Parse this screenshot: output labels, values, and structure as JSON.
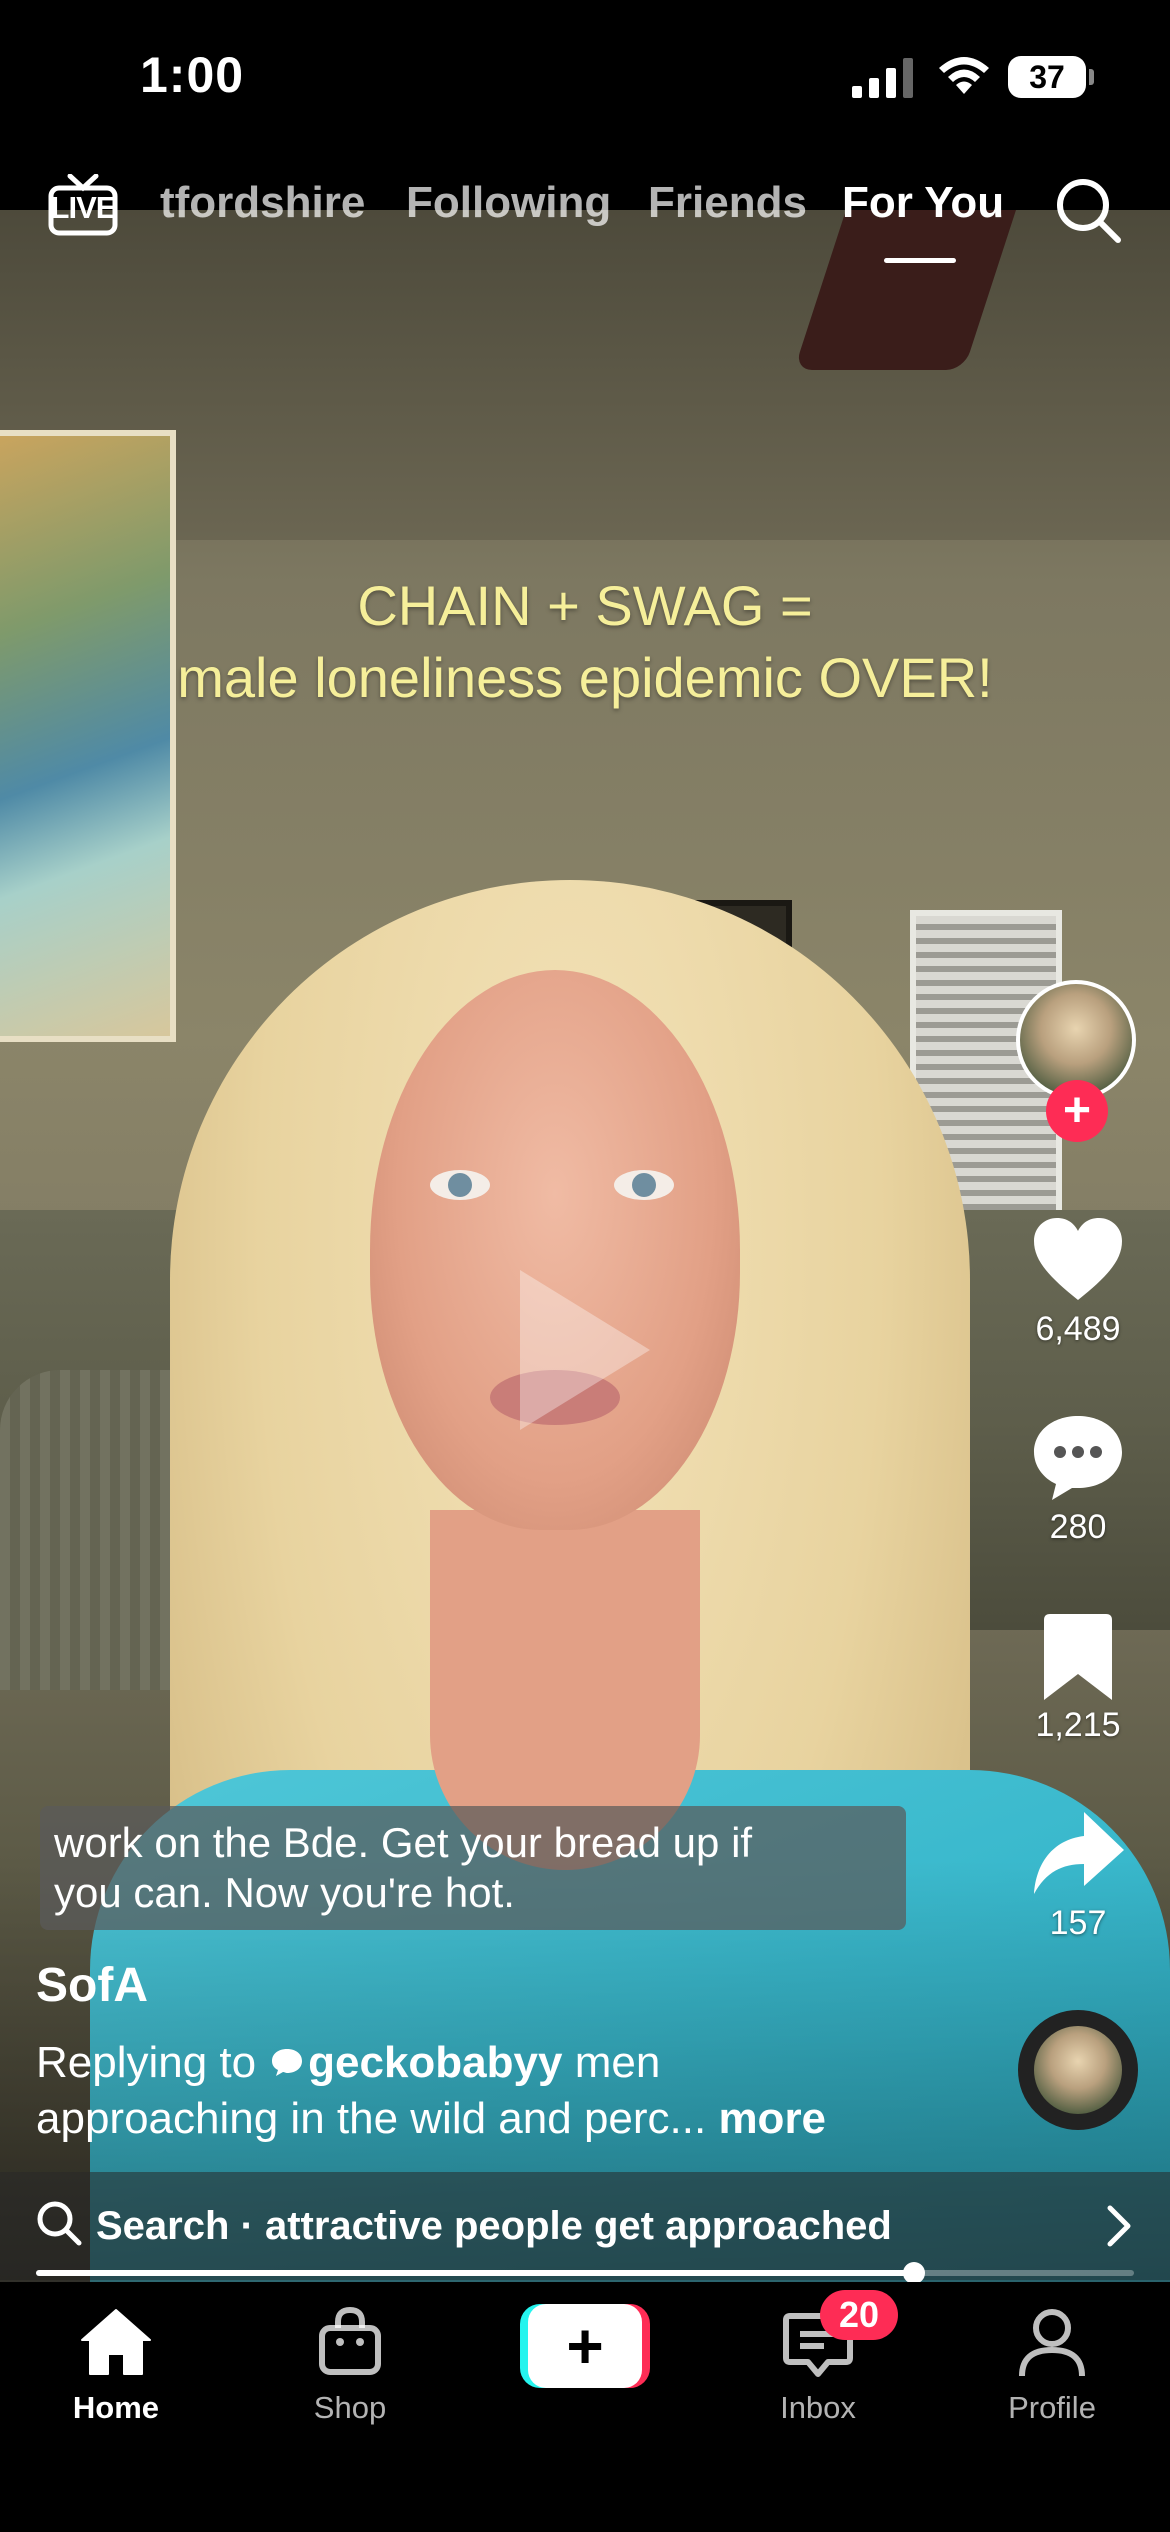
{
  "status_bar": {
    "time": "1:00",
    "battery": "37"
  },
  "top_nav": {
    "live_label": "LIVE",
    "tabs": [
      {
        "label": "tfordshire",
        "active": false
      },
      {
        "label": "Following",
        "active": false
      },
      {
        "label": "Friends",
        "active": false
      },
      {
        "label": "For You",
        "active": true
      }
    ],
    "search_icon": "search-icon"
  },
  "video": {
    "overlay_text_line1": "CHAIN + SWAG =",
    "overlay_text_line2": "male loneliness epidemic OVER!",
    "caption_line1": "work on the Bde. Get your bread up if",
    "caption_line2": "you can. Now you're hot.",
    "playback_progress": 0.8
  },
  "right_rail": {
    "follow_icon": "plus-icon",
    "likes": "6,489",
    "comments": "280",
    "saves": "1,215",
    "shares": "157"
  },
  "description": {
    "username": "SofA",
    "replying_prefix": "Replying to",
    "reply_handle": "geckobabyy",
    "line1_suffix": " men",
    "line2": "approaching in the wild and perc... ",
    "more_label": "more"
  },
  "search_strip": {
    "text": "Search · attractive people get approached"
  },
  "tab_bar": {
    "home": "Home",
    "shop": "Shop",
    "create": "+",
    "inbox": "Inbox",
    "inbox_badge": "20",
    "profile": "Profile"
  },
  "colors": {
    "accent_red": "#fe2c55",
    "accent_cyan": "#25f4ee",
    "overlay_text": "#f6ef9a"
  }
}
